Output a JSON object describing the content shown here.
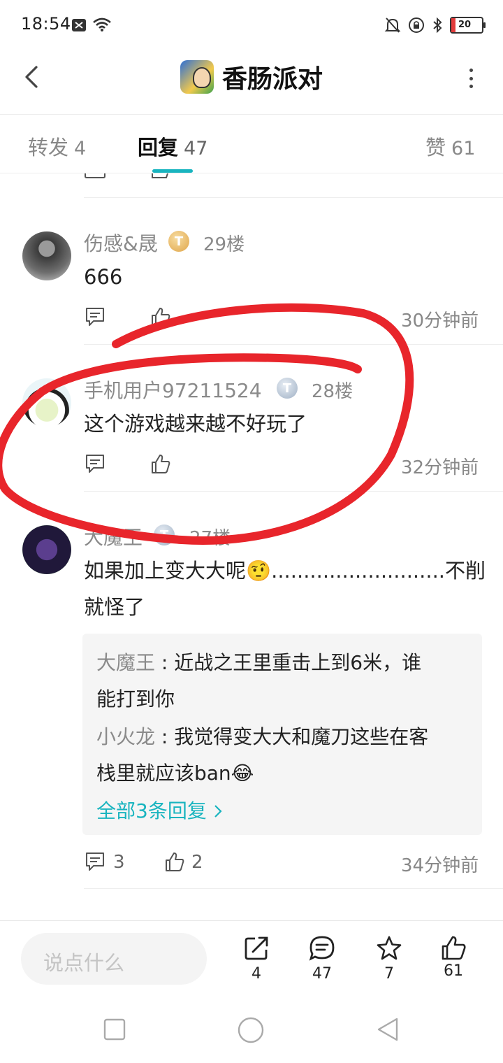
{
  "status_bar": {
    "time": "18:54",
    "battery": "20"
  },
  "header": {
    "title": "香肠派对"
  },
  "tabs": [
    {
      "label": "转发",
      "count": "4"
    },
    {
      "label": "回复",
      "count": "47"
    },
    {
      "label": "赞",
      "count": "61"
    }
  ],
  "comments": [
    {
      "username": "伤感&晟",
      "medal": "T4",
      "floor": "29楼",
      "text": "666",
      "time": "30分钟前"
    },
    {
      "username": "手机用户97211524",
      "medal": "T2",
      "floor": "28楼",
      "text": "这个游戏越来越不好玩了",
      "time": "32分钟前"
    },
    {
      "username": "大魔王",
      "medal": "T3",
      "floor": "27楼",
      "text_line1": "如果加上变大大呢🤨...........................不削",
      "text_line2": "就怪了",
      "replies": [
        {
          "name": "大魔王",
          "sep": " : ",
          "text_line1": "近战之王里重击上到6米，谁",
          "text_line2": "能打到你"
        },
        {
          "name": "小火龙",
          "sep": " : ",
          "text_line1": "我觉得变大大和魔刀这些在客",
          "text_line2": "栈里就应该ban😂"
        }
      ],
      "more_replies": "全部3条回复",
      "comment_count": "3",
      "like_count": "2",
      "time": "34分钟前"
    }
  ],
  "bottom_bar": {
    "input_placeholder": "说点什么",
    "share_count": "4",
    "comment_count": "47",
    "favorite_count": "7",
    "like_count": "61"
  },
  "colors": {
    "accent": "#18b4bf",
    "annotation": "#e8252b"
  }
}
